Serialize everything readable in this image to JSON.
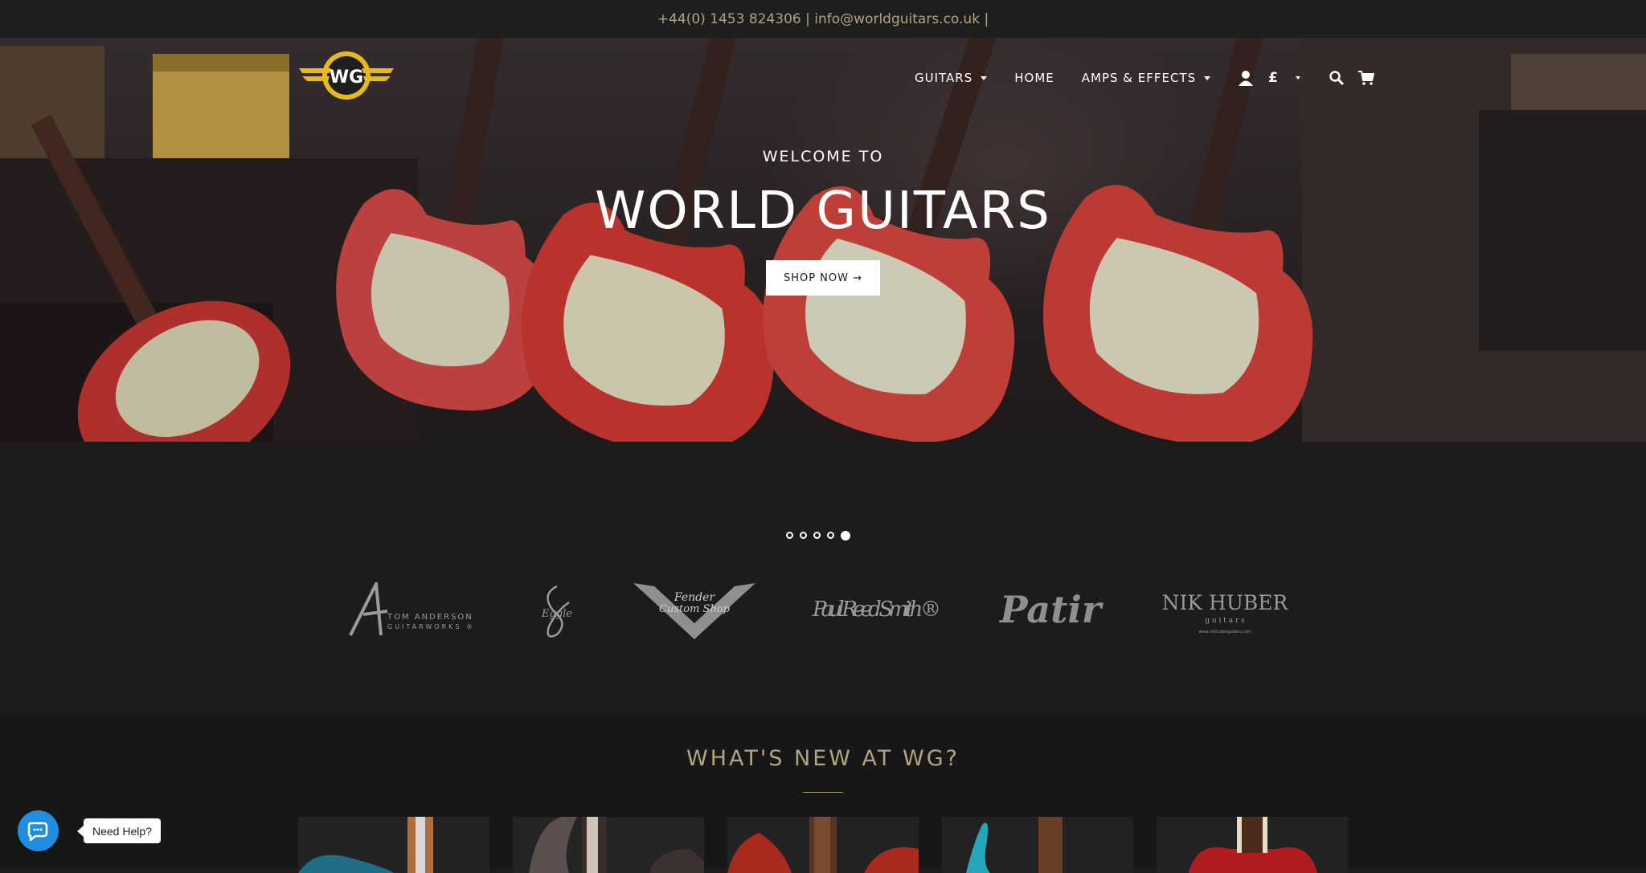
{
  "topbar": {
    "contact": "+44(0) 1453 824306 | info@worldguitars.co.uk |"
  },
  "header": {
    "logo_text": "WG",
    "nav": [
      {
        "label": "GUITARS",
        "has_dropdown": true
      },
      {
        "label": "HOME",
        "has_dropdown": false
      },
      {
        "label": "AMPS & EFFECTS",
        "has_dropdown": true
      }
    ],
    "currency": "£",
    "icons": [
      "account-icon",
      "currency-selector",
      "search-icon",
      "cart-icon"
    ]
  },
  "hero": {
    "welcome": "WELCOME TO",
    "title": "WORLD GUITARS",
    "button": "SHOP NOW →"
  },
  "carousel": {
    "dots": 5,
    "active_index": 4
  },
  "brands": [
    {
      "name": "tom-anderson-logo",
      "text": "TOM ANDERSON",
      "sub": "GUITARWORKS ®"
    },
    {
      "name": "patrick-eggle-logo",
      "text": "Eggle"
    },
    {
      "name": "fender-custom-shop-logo",
      "text": "Fender",
      "sub": "Custom Shop"
    },
    {
      "name": "paul-reed-smith-logo",
      "text": "Paul Reed Smith ®"
    },
    {
      "name": "patir-logo",
      "text": "Patir"
    },
    {
      "name": "nik-huber-logo",
      "text": "NIK HUBER",
      "sub": "g u i t a r s",
      "small": "www.nikhuberguitars.com"
    }
  ],
  "whats_new": {
    "title": "WHAT'S NEW AT WG?"
  },
  "products": [
    {
      "name": "product-1",
      "color": "#1f6d86"
    },
    {
      "name": "product-2",
      "color": "#3a3130"
    },
    {
      "name": "product-3",
      "color": "#a8291d"
    },
    {
      "name": "product-4",
      "color": "#26a7b9"
    },
    {
      "name": "product-5",
      "color": "#b31c1f"
    }
  ],
  "chat": {
    "label": "Need Help?"
  },
  "colors": {
    "accent": "#b3a47b",
    "background": "#1c1c1c",
    "chat": "#1f8ee0"
  }
}
